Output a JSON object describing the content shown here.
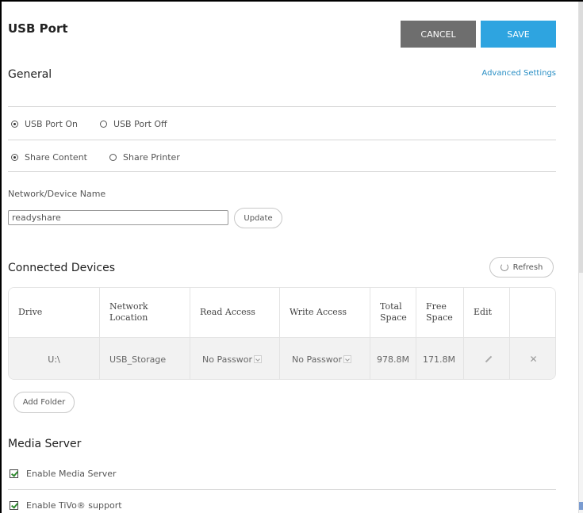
{
  "header": {
    "title": "USB Port",
    "cancel_label": "CANCEL",
    "save_label": "SAVE"
  },
  "general": {
    "heading": "General",
    "advanced_link": "Advanced Settings",
    "usb_port": {
      "on_label": "USB Port On",
      "off_label": "USB Port Off",
      "selected": "on"
    },
    "share": {
      "content_label": "Share Content",
      "printer_label": "Share Printer",
      "selected": "content"
    },
    "network_name": {
      "label": "Network/Device Name",
      "value": "readyshare",
      "update_label": "Update"
    }
  },
  "devices": {
    "heading": "Connected Devices",
    "refresh_label": "Refresh",
    "columns": {
      "drive": "Drive",
      "network_location_1": "Network",
      "network_location_2": "Location",
      "read": "Read Access",
      "write": "Write Access",
      "total_1": "Total",
      "total_2": "Space",
      "free_1": "Free",
      "free_2": "Space",
      "edit": "Edit"
    },
    "rows": [
      {
        "drive": "U:\\",
        "location": "USB_Storage",
        "read": "No Passwor",
        "write": "No Passwor",
        "total": "978.8M",
        "free": "171.8M"
      }
    ],
    "add_folder_label": "Add Folder"
  },
  "media": {
    "heading": "Media Server",
    "enable_media_label": "Enable Media Server",
    "enable_tivo_label": "Enable TiVo® support",
    "enable_media_checked": true,
    "enable_tivo_checked": true
  }
}
